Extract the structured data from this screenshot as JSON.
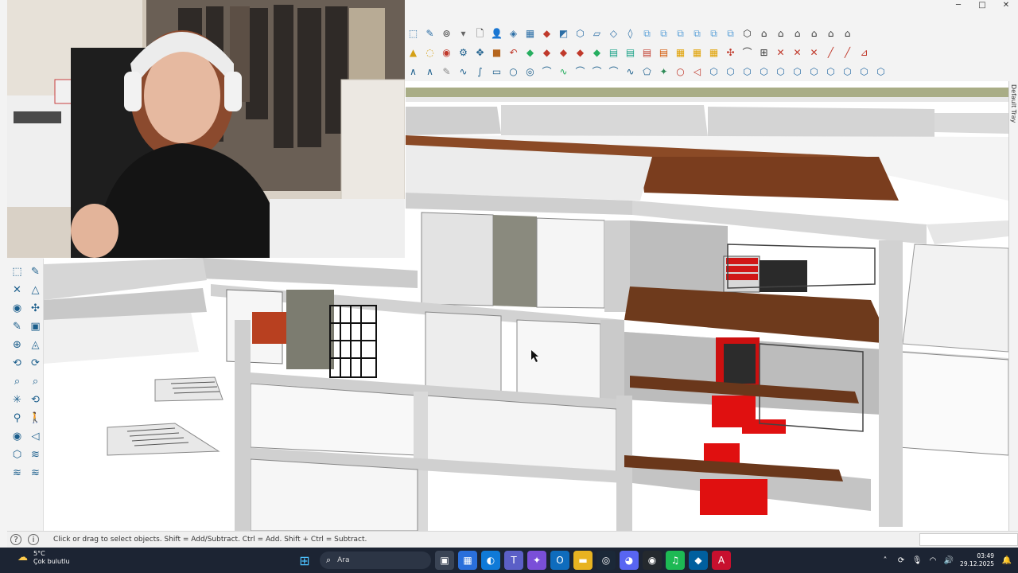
{
  "window": {
    "controls": {
      "minimize": "─",
      "maximize": "□",
      "close": "✕"
    }
  },
  "toolbars": {
    "row1": [
      {
        "name": "select-icon",
        "glyph": "⬚",
        "color": "#2b6ea6"
      },
      {
        "name": "eraser-icon",
        "glyph": "✎",
        "color": "#2b6ea6"
      },
      {
        "name": "orbit-icon",
        "glyph": "⊚",
        "color": "#333"
      },
      {
        "name": "dropdown-icon",
        "glyph": "▾",
        "color": "#666"
      },
      {
        "name": "new-file-icon",
        "glyph": "🗋",
        "color": "#333"
      },
      {
        "name": "user-icon",
        "glyph": "👤",
        "color": "#1b5e8c"
      },
      {
        "name": "paint-bucket-icon",
        "glyph": "◈",
        "color": "#2b6ea6"
      },
      {
        "name": "layers-icon",
        "glyph": "▦",
        "color": "#2b6ea6"
      },
      {
        "name": "section-plane-icon",
        "glyph": "◆",
        "color": "#c0392b"
      },
      {
        "name": "component-icon",
        "glyph": "◩",
        "color": "#2b6ea6"
      },
      {
        "name": "iso-view-icon",
        "glyph": "⬡",
        "color": "#2b6ea6"
      },
      {
        "name": "top-view-icon",
        "glyph": "▱",
        "color": "#2b6ea6"
      },
      {
        "name": "front-view-icon",
        "glyph": "◇",
        "color": "#2b6ea6"
      },
      {
        "name": "right-view-icon",
        "glyph": "◊",
        "color": "#2b6ea6"
      },
      {
        "name": "copy-icon",
        "glyph": "⧉",
        "color": "#5aa0d8"
      },
      {
        "name": "paste-icon",
        "glyph": "⧉",
        "color": "#5aa0d8"
      },
      {
        "name": "group-icon",
        "glyph": "⧉",
        "color": "#5aa0d8"
      },
      {
        "name": "ungroup-icon",
        "glyph": "⧉",
        "color": "#5aa0d8"
      },
      {
        "name": "lock-icon",
        "glyph": "⧉",
        "color": "#5aa0d8"
      },
      {
        "name": "unlock-icon",
        "glyph": "⧉",
        "color": "#5aa0d8"
      },
      {
        "name": "box-view-icon",
        "glyph": "⬡",
        "color": "#333"
      },
      {
        "name": "house-front-icon",
        "glyph": "⌂",
        "color": "#333"
      },
      {
        "name": "house-side-icon",
        "glyph": "⌂",
        "color": "#333"
      },
      {
        "name": "house-back-icon",
        "glyph": "⌂",
        "color": "#333"
      },
      {
        "name": "house-left-icon",
        "glyph": "⌂",
        "color": "#333"
      },
      {
        "name": "house-bottom-icon",
        "glyph": "⌂",
        "color": "#333"
      },
      {
        "name": "house-top-icon",
        "glyph": "⌂",
        "color": "#333"
      }
    ],
    "row2": [
      {
        "name": "warning-icon",
        "glyph": "▲",
        "color": "#d4a017"
      },
      {
        "name": "lasso-icon",
        "glyph": "◌",
        "color": "#d4a017"
      },
      {
        "name": "eye-icon",
        "glyph": "◉",
        "color": "#c0392b"
      },
      {
        "name": "gear-icon",
        "glyph": "⚙",
        "color": "#1b5e8c"
      },
      {
        "name": "move-icon",
        "glyph": "✥",
        "color": "#1b5e8c"
      },
      {
        "name": "cube-icon",
        "glyph": "■",
        "color": "#b5651d"
      },
      {
        "name": "undo-icon",
        "glyph": "↶",
        "color": "#c0392b"
      },
      {
        "name": "plugin-a-icon",
        "glyph": "◆",
        "color": "#27ae60"
      },
      {
        "name": "plugin-b-icon",
        "glyph": "◆",
        "color": "#c0392b"
      },
      {
        "name": "plugin-c-icon",
        "glyph": "◆",
        "color": "#c0392b"
      },
      {
        "name": "plugin-d-icon",
        "glyph": "◆",
        "color": "#c0392b"
      },
      {
        "name": "plugin-e-icon",
        "glyph": "◆",
        "color": "#27ae60"
      },
      {
        "name": "plugin-f-icon",
        "glyph": "▤",
        "color": "#16a085"
      },
      {
        "name": "plugin-g-icon",
        "glyph": "▤",
        "color": "#16a085"
      },
      {
        "name": "plugin-h-icon",
        "glyph": "▤",
        "color": "#c0392b"
      },
      {
        "name": "plugin-i-icon",
        "glyph": "▤",
        "color": "#d35400"
      },
      {
        "name": "grid-a-icon",
        "glyph": "▦",
        "color": "#e0a000"
      },
      {
        "name": "grid-b-icon",
        "glyph": "▦",
        "color": "#e0a000"
      },
      {
        "name": "grid-c-icon",
        "glyph": "▦",
        "color": "#e0a000"
      },
      {
        "name": "scatter-icon",
        "glyph": "✣",
        "color": "#c0392b"
      },
      {
        "name": "arc-tool-icon",
        "glyph": "⌒",
        "color": "#333"
      },
      {
        "name": "dimension-icon",
        "glyph": "⊞",
        "color": "#333"
      },
      {
        "name": "cross-a-icon",
        "glyph": "✕",
        "color": "#c0392b"
      },
      {
        "name": "cross-b-icon",
        "glyph": "✕",
        "color": "#c0392b"
      },
      {
        "name": "cross-c-icon",
        "glyph": "✕",
        "color": "#c0392b"
      },
      {
        "name": "line-a-icon",
        "glyph": "╱",
        "color": "#c0392b"
      },
      {
        "name": "line-b-icon",
        "glyph": "╱",
        "color": "#c0392b"
      },
      {
        "name": "frame-icon",
        "glyph": "⊿",
        "color": "#c0392b"
      }
    ],
    "row3": [
      {
        "name": "curve-a-icon",
        "glyph": "∧",
        "color": "#1b5e8c"
      },
      {
        "name": "curve-b-icon",
        "glyph": "∧",
        "color": "#1b5e8c"
      },
      {
        "name": "pencil-icon",
        "glyph": "✎",
        "color": "#888"
      },
      {
        "name": "wave-icon",
        "glyph": "∿",
        "color": "#1b5e8c"
      },
      {
        "name": "spline-icon",
        "glyph": "∫",
        "color": "#1b5e8c"
      },
      {
        "name": "rectangle-icon",
        "glyph": "▭",
        "color": "#1b5e8c"
      },
      {
        "name": "circle-icon",
        "glyph": "○",
        "color": "#1b5e8c"
      },
      {
        "name": "target-icon",
        "glyph": "◎",
        "color": "#1b5e8c"
      },
      {
        "name": "arc-a-icon",
        "glyph": "⌒",
        "color": "#1b5e8c"
      },
      {
        "name": "arc-b-icon",
        "glyph": "∿",
        "color": "#27ae60"
      },
      {
        "name": "arc-c-icon",
        "glyph": "⌒",
        "color": "#1b5e8c"
      },
      {
        "name": "arc-d-icon",
        "glyph": "⌒",
        "color": "#1b5e8c"
      },
      {
        "name": "arc-e-icon",
        "glyph": "⌒",
        "color": "#1b5e8c"
      },
      {
        "name": "zigzag-icon",
        "glyph": "∿",
        "color": "#1b5e8c"
      },
      {
        "name": "polygon-icon",
        "glyph": "⬠",
        "color": "#1b5e8c"
      },
      {
        "name": "wrench-icon",
        "glyph": "✦",
        "color": "#2e8b57"
      },
      {
        "name": "oval-icon",
        "glyph": "○",
        "color": "#c0392b"
      },
      {
        "name": "tag-icon",
        "glyph": "◁",
        "color": "#c0392b"
      },
      {
        "name": "node-a-icon",
        "glyph": "⬡",
        "color": "#2b6ea6"
      },
      {
        "name": "node-b-icon",
        "glyph": "⬡",
        "color": "#2b6ea6"
      },
      {
        "name": "node-c-icon",
        "glyph": "⬡",
        "color": "#2b6ea6"
      },
      {
        "name": "node-d-icon",
        "glyph": "⬡",
        "color": "#2b6ea6"
      },
      {
        "name": "node-e-icon",
        "glyph": "⬡",
        "color": "#2b6ea6"
      },
      {
        "name": "node-f-icon",
        "glyph": "⬡",
        "color": "#2b6ea6"
      },
      {
        "name": "node-g-icon",
        "glyph": "⬡",
        "color": "#2b6ea6"
      },
      {
        "name": "node-h-icon",
        "glyph": "⬡",
        "color": "#2b6ea6"
      },
      {
        "name": "node-i-icon",
        "glyph": "⬡",
        "color": "#2b6ea6"
      },
      {
        "name": "node-j-icon",
        "glyph": "⬡",
        "color": "#2b6ea6"
      },
      {
        "name": "node-k-icon",
        "glyph": "⬡",
        "color": "#2b6ea6"
      }
    ]
  },
  "left_toolbar": [
    {
      "name": "select-tool-icon",
      "glyph": "⬚"
    },
    {
      "name": "eraser-tool-icon",
      "glyph": "✎"
    },
    {
      "name": "line-tool-icon",
      "glyph": "✕"
    },
    {
      "name": "triangle-tool-icon",
      "glyph": "△"
    },
    {
      "name": "paint-tool-icon",
      "glyph": "◉"
    },
    {
      "name": "spray-tool-icon",
      "glyph": "✣"
    },
    {
      "name": "tape-tool-icon",
      "glyph": "✎"
    },
    {
      "name": "text-tool-icon",
      "glyph": "▣"
    },
    {
      "name": "compass-tool-icon",
      "glyph": "⊕"
    },
    {
      "name": "protractor-tool-icon",
      "glyph": "◬"
    },
    {
      "name": "orbit-tool-icon",
      "glyph": "⟲"
    },
    {
      "name": "rotate-tool-icon",
      "glyph": "⟳"
    },
    {
      "name": "zoom-tool-icon",
      "glyph": "⌕"
    },
    {
      "name": "zoom-window-icon",
      "glyph": "⌕"
    },
    {
      "name": "zoom-extents-icon",
      "glyph": "✳"
    },
    {
      "name": "previous-view-icon",
      "glyph": "⟲"
    },
    {
      "name": "position-camera-icon",
      "glyph": "⚲"
    },
    {
      "name": "walk-tool-icon",
      "glyph": "🚶"
    },
    {
      "name": "look-around-icon",
      "glyph": "◉"
    },
    {
      "name": "section-tool-icon",
      "glyph": "◁"
    },
    {
      "name": "component-tool-icon",
      "glyph": "⬡"
    },
    {
      "name": "sandbox-tool-icon",
      "glyph": "≋"
    },
    {
      "name": "layer-tool-icon",
      "glyph": "≋"
    },
    {
      "name": "terrain-tool-icon",
      "glyph": "≋"
    }
  ],
  "tray": {
    "label": "Default Tray"
  },
  "statusbar": {
    "help_icon": "?",
    "info_icon": "i",
    "text": "Click or drag to select objects. Shift = Add/Subtract. Ctrl = Add. Shift + Ctrl = Subtract."
  },
  "taskbar": {
    "weather": {
      "temp": "5°C",
      "desc": "Çok bulutlu",
      "icon": "☁"
    },
    "search_placeholder": "Ara",
    "search_icon": "⌕",
    "start_icon": "⊞",
    "apps": [
      {
        "name": "task-view-app",
        "glyph": "▣",
        "bg": "#3a4455"
      },
      {
        "name": "store-app",
        "glyph": "▦",
        "bg": "#2a6fdb"
      },
      {
        "name": "edge-app",
        "glyph": "◐",
        "bg": "#0f7ad8"
      },
      {
        "name": "teams-app",
        "glyph": "T",
        "bg": "#5b5fc7"
      },
      {
        "name": "copilot-app",
        "glyph": "✦",
        "bg": "#7a4fd8"
      },
      {
        "name": "outlook-app",
        "glyph": "O",
        "bg": "#0f6cbd"
      },
      {
        "name": "explorer-app",
        "glyph": "▬",
        "bg": "#e8b321"
      },
      {
        "name": "steam-app",
        "glyph": "◎",
        "bg": "#1b2838"
      },
      {
        "name": "discord-app",
        "glyph": "◕",
        "bg": "#5865f2"
      },
      {
        "name": "github-app",
        "glyph": "◉",
        "bg": "#24292e"
      },
      {
        "name": "spotify-app",
        "glyph": "♫",
        "bg": "#1db954"
      },
      {
        "name": "sketchup-app",
        "glyph": "◆",
        "bg": "#005f9e"
      },
      {
        "name": "acrobat-app",
        "glyph": "A",
        "bg": "#c8102e"
      }
    ],
    "tray_icons": [
      {
        "name": "chevron-up-icon",
        "glyph": "˄"
      },
      {
        "name": "sync-icon",
        "glyph": "⟳"
      },
      {
        "name": "mic-icon",
        "glyph": "🎙"
      },
      {
        "name": "wifi-icon",
        "glyph": "◠"
      },
      {
        "name": "volume-icon",
        "glyph": "🔊"
      }
    ],
    "time": "03:49",
    "date": "29.12.2025",
    "notification_icon": "🔔"
  }
}
